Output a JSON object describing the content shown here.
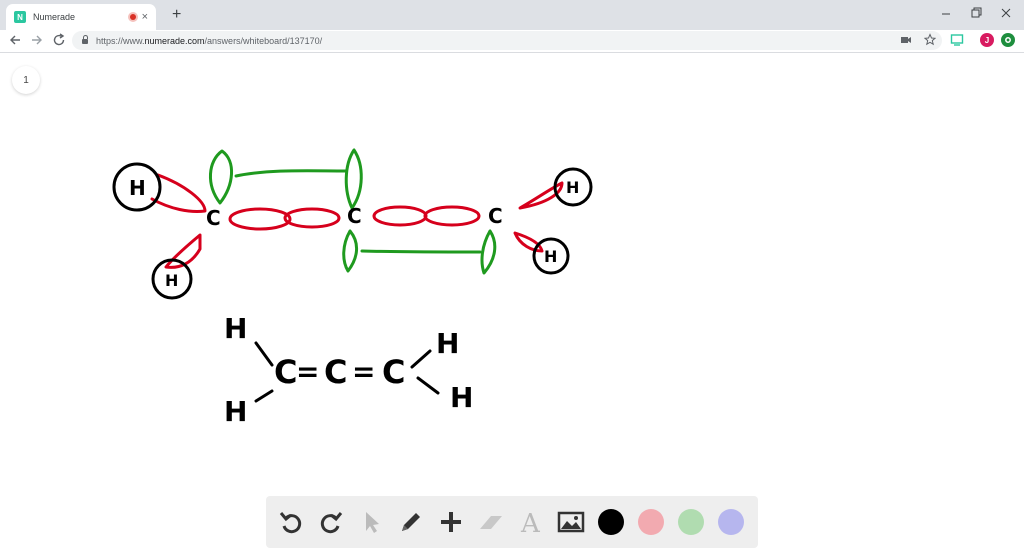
{
  "browser": {
    "tab_title": "Numerade",
    "favicon_letter": "N",
    "new_tab_glyph": "+",
    "close_glyph": "×",
    "url_scheme": "https://www.",
    "url_domain": "numerade.com",
    "url_path": "/answers/whiteboard/137170/",
    "profile_initial": "J"
  },
  "whiteboard": {
    "page_number": "1",
    "atoms": {
      "carbon": "C",
      "hydrogen": "H",
      "bond_double": "="
    },
    "colors": {
      "ink": "#000000",
      "sigma_orbital": "#d6001c",
      "pi_orbital": "#1f9a1f"
    },
    "tools": [
      {
        "name": "undo-icon"
      },
      {
        "name": "redo-icon"
      },
      {
        "name": "pointer-icon"
      },
      {
        "name": "pen-icon"
      },
      {
        "name": "add-icon"
      },
      {
        "name": "eraser-icon"
      },
      {
        "name": "text-icon",
        "glyph": "A"
      },
      {
        "name": "image-icon"
      }
    ],
    "swatches": [
      "#000000",
      "#f2aab0",
      "#b0dcb0",
      "#b6b6ee"
    ]
  }
}
